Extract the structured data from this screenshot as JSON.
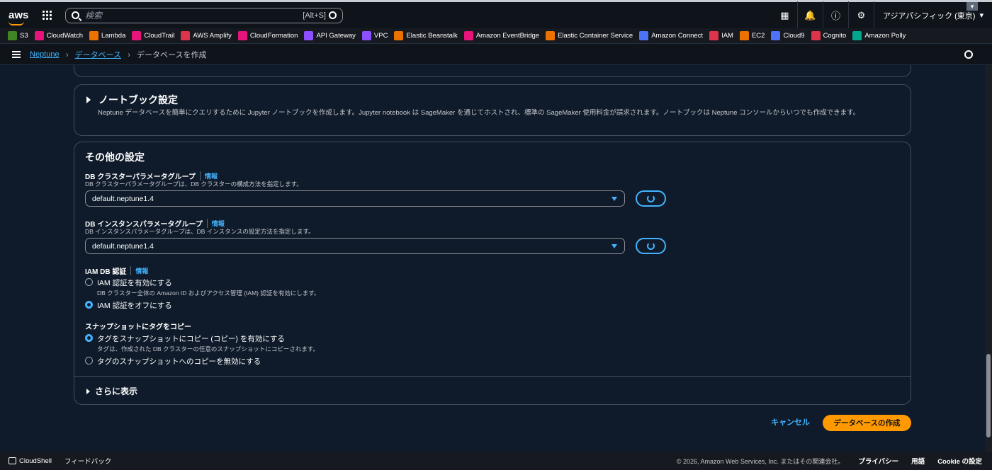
{
  "topnav": {
    "logo": "aws",
    "search_placeholder": "検索",
    "search_shortcut": "[Alt+S]",
    "region": "アジアパシフィック (東京)",
    "icons": [
      "cloudshell-icon",
      "bell-icon",
      "help-icon",
      "gear-icon"
    ]
  },
  "favorites": [
    {
      "label": "S3",
      "color": "#3f8624"
    },
    {
      "label": "CloudWatch",
      "color": "#e7157b"
    },
    {
      "label": "Lambda",
      "color": "#ed7100"
    },
    {
      "label": "CloudTrail",
      "color": "#e7157b"
    },
    {
      "label": "AWS Amplify",
      "color": "#dd344c"
    },
    {
      "label": "CloudFormation",
      "color": "#e7157b"
    },
    {
      "label": "API Gateway",
      "color": "#8c4fff"
    },
    {
      "label": "VPC",
      "color": "#8c4fff"
    },
    {
      "label": "Elastic Beanstalk",
      "color": "#ed7100"
    },
    {
      "label": "Amazon EventBridge",
      "color": "#e7157b"
    },
    {
      "label": "Elastic Container Service",
      "color": "#ed7100"
    },
    {
      "label": "Amazon Connect",
      "color": "#4d72f3"
    },
    {
      "label": "IAM",
      "color": "#dd344c"
    },
    {
      "label": "EC2",
      "color": "#ed7100"
    },
    {
      "label": "Cloud9",
      "color": "#4d72f3"
    },
    {
      "label": "Cognito",
      "color": "#dd344c"
    },
    {
      "label": "Amazon Polly",
      "color": "#01a88d"
    }
  ],
  "breadcrumb": {
    "items": [
      "Neptune",
      "データベース"
    ],
    "current": "データベースを作成"
  },
  "notebook": {
    "title": "ノートブック設定",
    "description": "Neptune データベースを簡単にクエリするために Jupyter ノートブックを作成します。Jupyter notebook は SageMaker を通じてホストされ、標準の SageMaker 使用料金が請求されます。ノートブックは Neptune コンソールからいつでも作成できます。"
  },
  "other": {
    "title": "その他の設定",
    "info": "情報",
    "cluster_param": {
      "label": "DB クラスターパラメータグループ",
      "desc": "DB クラスターパラメータグループは、DB クラスターの構成方法を指定します。",
      "value": "default.neptune1.4"
    },
    "instance_param": {
      "label": "DB インスタンスパラメータグループ",
      "desc": "DB インスタンスパラメータグループは、DB インスタンスの設定方法を指定します。",
      "value": "default.neptune1.4"
    },
    "iam": {
      "label": "IAM DB 認証",
      "opt1": "IAM 認証を有効にする",
      "opt1_desc": "DB クラスター全体の Amazon ID およびアクセス管理 (IAM) 認証を有効にします。",
      "opt2": "IAM 認証をオフにする",
      "selected": "opt2"
    },
    "snapshot": {
      "label": "スナップショットにタグをコピー",
      "opt1": "タグをスナップショットにコピー (コピー) を有効にする",
      "opt1_desc": "タグは、作成された DB クラスターの任意のスナップショットにコピーされます。",
      "opt2": "タグのスナップショットへのコピーを無効にする",
      "selected": "opt1"
    },
    "more": "さらに表示"
  },
  "actions": {
    "cancel": "キャンセル",
    "create": "データベースの作成"
  },
  "footer": {
    "cloudshell": "CloudShell",
    "feedback": "フィードバック",
    "copyright": "© 2026, Amazon Web Services, Inc. またはその関連会社。",
    "privacy": "プライバシー",
    "terms": "用語",
    "cookie": "Cookie の設定"
  }
}
